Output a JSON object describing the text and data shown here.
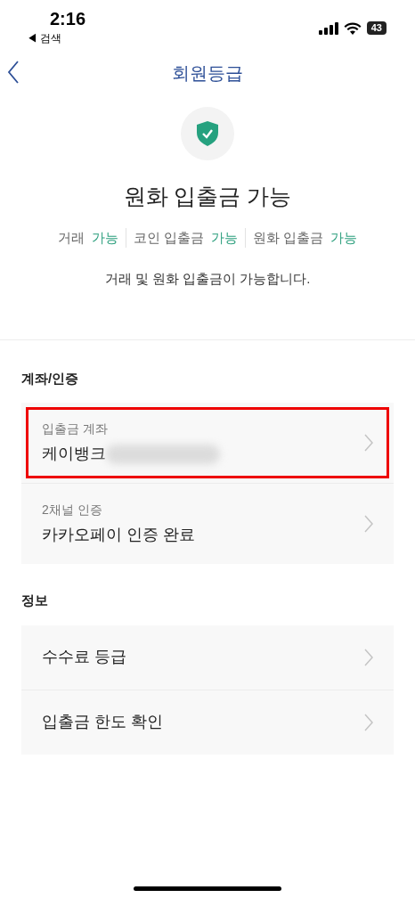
{
  "status_bar": {
    "time": "2:16",
    "back_app": "◀ 검색",
    "battery": "43"
  },
  "nav": {
    "title": "회원등급"
  },
  "grade": {
    "title": "원화 입출금 가능",
    "features": [
      {
        "label": "거래",
        "value": "가능"
      },
      {
        "label": "코인 입출금",
        "value": "가능"
      },
      {
        "label": "원화 입출금",
        "value": "가능"
      }
    ],
    "description": "거래 및 원화 입출금이 가능합니다."
  },
  "sections": [
    {
      "title": "계좌/인증",
      "items": [
        {
          "label": "입출금 계좌",
          "value": "케이뱅크",
          "redacted": true,
          "highlighted": true
        },
        {
          "label": "2채널 인증",
          "value": "카카오페이 인증 완료",
          "redacted": false,
          "highlighted": false
        }
      ]
    },
    {
      "title": "정보",
      "items": [
        {
          "value": "수수료 등급",
          "redacted": false,
          "highlighted": false
        },
        {
          "value": "입출금 한도 확인",
          "redacted": false,
          "highlighted": false
        }
      ]
    }
  ]
}
